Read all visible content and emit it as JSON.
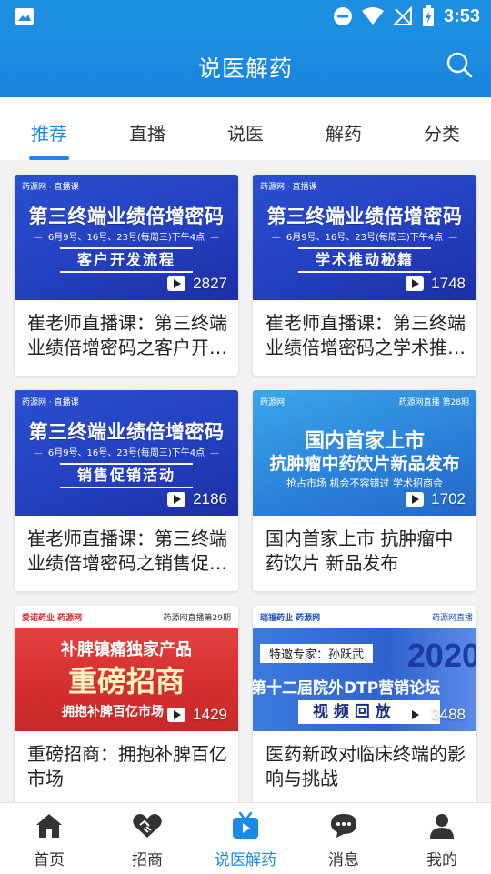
{
  "status": {
    "time": "3:53"
  },
  "app": {
    "title": "说医解药"
  },
  "tabs": [
    "推荐",
    "直播",
    "说医",
    "解药",
    "分类"
  ],
  "cards": [
    {
      "brand": "药源网 · 直播课",
      "headline": "第三终端业绩倍增密码",
      "date": "6月9号、16号、23号(每周三)下午4点",
      "sub": "客户开发流程",
      "views": "2827",
      "title": "崔老师直播课：第三终端业绩倍增密码之客户开发流程"
    },
    {
      "brand": "药源网 · 直播课",
      "headline": "第三终端业绩倍增密码",
      "date": "6月9号、16号、23号(每周三)下午4点",
      "sub": "学术推动秘籍",
      "views": "1748",
      "title": "崔老师直播课：第三终端业绩倍增密码之学术推动秘籍"
    },
    {
      "brand": "药源网 · 直播课",
      "headline": "第三终端业绩倍增密码",
      "date": "6月9号、16号、23号(每周三)下午4点",
      "sub": "销售促销活动",
      "views": "2186",
      "title": "崔老师直播课：第三终端业绩倍增密码之销售促销活动"
    },
    {
      "brand": "药源网",
      "brand_right": "药源网直播 第28期",
      "headline": "国内首家上市",
      "headline2": "抗肿瘤中药饮片新品发布",
      "date": "抢占市场  机会不容错过  学术招商会",
      "views": "1702",
      "title": "国内首家上市 抗肿瘤中药饮片 新品发布"
    },
    {
      "brand": "爱诺药业  药源网",
      "brand_right": "药源网直播第29期",
      "headline": "补脾镇痛独家产品",
      "headline2": "重磅招商",
      "date": "拥抱补脾百亿市场",
      "views": "1429",
      "title": "重磅招商：拥抱补脾百亿市场"
    },
    {
      "brand": "瑞福药业  药源网",
      "brand_right": "药源网直播",
      "headline": "特邀专家：孙跃武",
      "headline2": "第十二届院外DTP营销论坛",
      "year": "2020",
      "date": "视 频 回 放",
      "views": "3488",
      "title": "医药新政对临床终端的影响与挑战"
    }
  ],
  "nav": [
    {
      "label": "首页",
      "icon": "home-icon"
    },
    {
      "label": "招商",
      "icon": "handshake-icon"
    },
    {
      "label": "说医解药",
      "icon": "tv-play-icon"
    },
    {
      "label": "消息",
      "icon": "chat-icon"
    },
    {
      "label": "我的",
      "icon": "person-icon"
    }
  ]
}
